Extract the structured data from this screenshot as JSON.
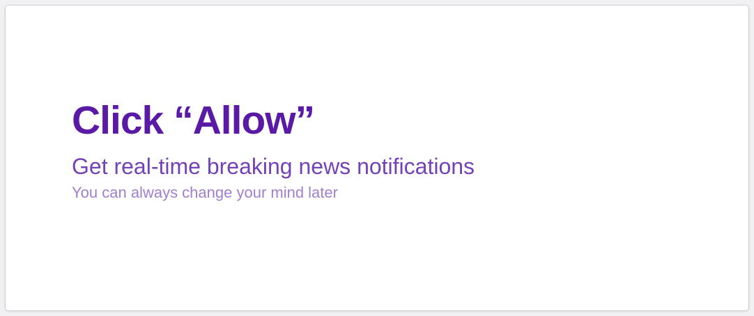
{
  "prompt": {
    "headline": "Click “Allow”",
    "subheadline": "Get real-time breaking news notifications",
    "note": "You can always change your mind later"
  },
  "colors": {
    "headline": "#5a1aa6",
    "subheadline": "#7442b8",
    "note": "#a17fcf",
    "card_background": "#ffffff",
    "page_background": "#f1f1f3"
  }
}
